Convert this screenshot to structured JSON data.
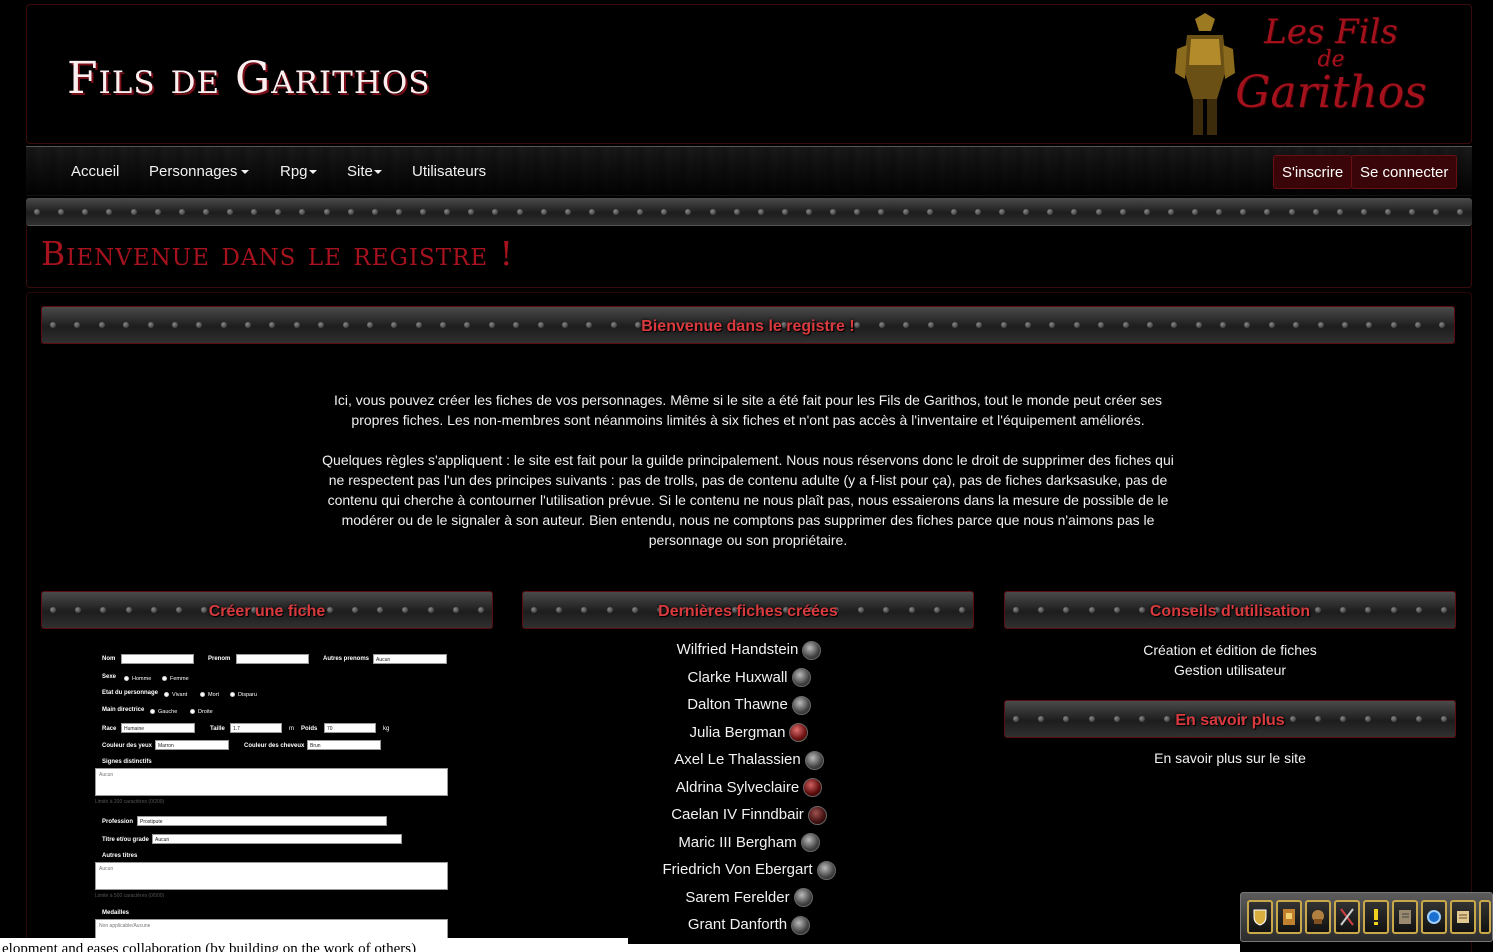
{
  "header": {
    "site_title": "Fils de Garithos",
    "logo_line1": "Les Fils",
    "logo_line2": "de",
    "logo_line3": "Garithos"
  },
  "nav": {
    "items": [
      "Accueil",
      "Personnages",
      "Rpg",
      "Site",
      "Utilisateurs"
    ],
    "register": "S'inscrire",
    "login": "Se connecter"
  },
  "page": {
    "heading": "Bienvenue dans le registre !",
    "section_title": "Bienvenue dans le registre !",
    "intro_p1": "Ici, vous pouvez créer les fiches de vos personnages. Même si le site a été fait pour les Fils de Garithos, tout le monde peut créer ses propres fiches. Les non-membres sont néanmoins limités à six fiches et n'ont pas accès à l'inventaire et l'équipement améliorés.",
    "intro_p2": "Quelques règles s'appliquent : le site est fait pour la guilde principalement. Nous nous réservons donc le droit de supprimer des fiches qui ne respectent pas l'un des principes suivants : pas de trolls, pas de contenu adulte (y a f-list pour ça), pas de fiches darksasuke, pas de contenu qui cherche à contourner l'utilisation prévue. Si le contenu ne nous plaît pas, nous essaierons dans la mesure de possible de le modérer ou de le signaler à son auteur. Bien entendu, nous ne comptons pas supprimer des fiches parce que nous n'aimons pas le personnage ou son propriétaire."
  },
  "create": {
    "title": "Créer une fiche",
    "form": {
      "nom": "Nom",
      "prenom": "Prenom",
      "autres_prenoms": "Autres prenoms",
      "autres_prenoms_val": "Aucun",
      "sexe": "Sexe",
      "homme": "Homme",
      "femme": "Femme",
      "etat": "Etat du personnage",
      "vivant": "Vivant",
      "mort": "Mort",
      "disparu": "Disparu",
      "main": "Main directrice",
      "gauche": "Gauche",
      "droite": "Droite",
      "race": "Race",
      "race_val": "Humaine",
      "taille": "Taille",
      "taille_val": "1.7",
      "taille_unit": "m",
      "poids": "Poids",
      "poids_val": "70",
      "poids_unit": "kg",
      "yeux": "Couleur des yeux",
      "yeux_val": "Marron",
      "cheveux": "Couleur des cheveux",
      "cheveux_val": "Brun",
      "signes": "Signes distinctifs",
      "signes_val": "Aucun",
      "signes_hint": "Limité à 200 caractères (0/200)",
      "profession": "Profession",
      "profession_val": "Prostipute",
      "titre": "Titre et/ou grade",
      "titre_val": "Aucun",
      "autres_titres": "Autres titres",
      "autres_titres_val": "Aucun",
      "autres_titres_hint": "Limité à 500 caractères (0/500)",
      "medailles": "Medailles",
      "medailles_val": "Non applicable/Aucune"
    }
  },
  "latest": {
    "title": "Dernières fiches créées",
    "names": [
      "Wilfried Handstein",
      "Clarke Huxwall",
      "Dalton Thawne",
      "Julia Bergman",
      "Axel Le Thalassien",
      "Aldrina Sylveclaire",
      "Caelan IV Finndbair",
      "Maric III Bergham",
      "Friedrich Von Ebergart",
      "Sarem Ferelder",
      "Grant Danforth"
    ]
  },
  "tips": {
    "title": "Conseils d'utilisation",
    "link1": "Création et édition de fiches",
    "link2": "Gestion utilisateur"
  },
  "more": {
    "title": "En savoir plus",
    "link": "En savoir plus sur le site"
  },
  "overlay": {
    "bottom_text": "elopment and eases collaboration (by building on the work of others)",
    "toolbar_icons": [
      "shield-icon",
      "banner-icon",
      "helmet-icon",
      "crossed-axes-icon",
      "alert-icon",
      "book-icon",
      "portal-icon",
      "scroll-icon",
      "more-icon"
    ]
  },
  "colors": {
    "accent_red": "#d83a3e",
    "heading_red": "#a6121d",
    "button_bg": "#3a0508"
  }
}
